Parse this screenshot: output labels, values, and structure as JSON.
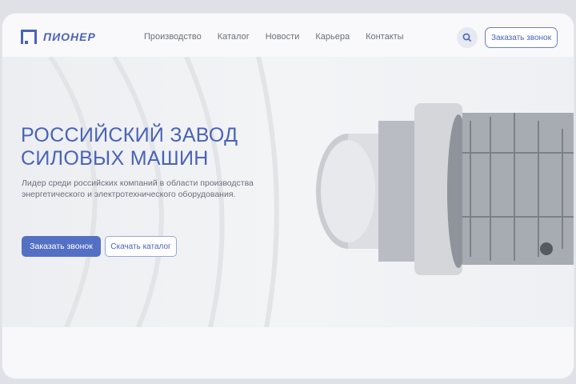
{
  "header": {
    "logo": "ПИОНЕР",
    "nav": [
      "Производство",
      "Каталог",
      "Новости",
      "Карьера",
      "Контакты"
    ],
    "callback": "Заказать звонок"
  },
  "hero": {
    "title_line1": "РОССИЙСКИЙ ЗАВОД",
    "title_line2": "СИЛОВЫХ МАШИН",
    "subtitle_line1": "Лидер среди российских компаний в области производства",
    "subtitle_line2": "энергетического и электротехнического оборудования.",
    "primary_button": "Заказать звонок",
    "secondary_button": "Скачать каталог"
  },
  "colors": {
    "accent": "#5470c4",
    "text": "#6b6f7b"
  }
}
